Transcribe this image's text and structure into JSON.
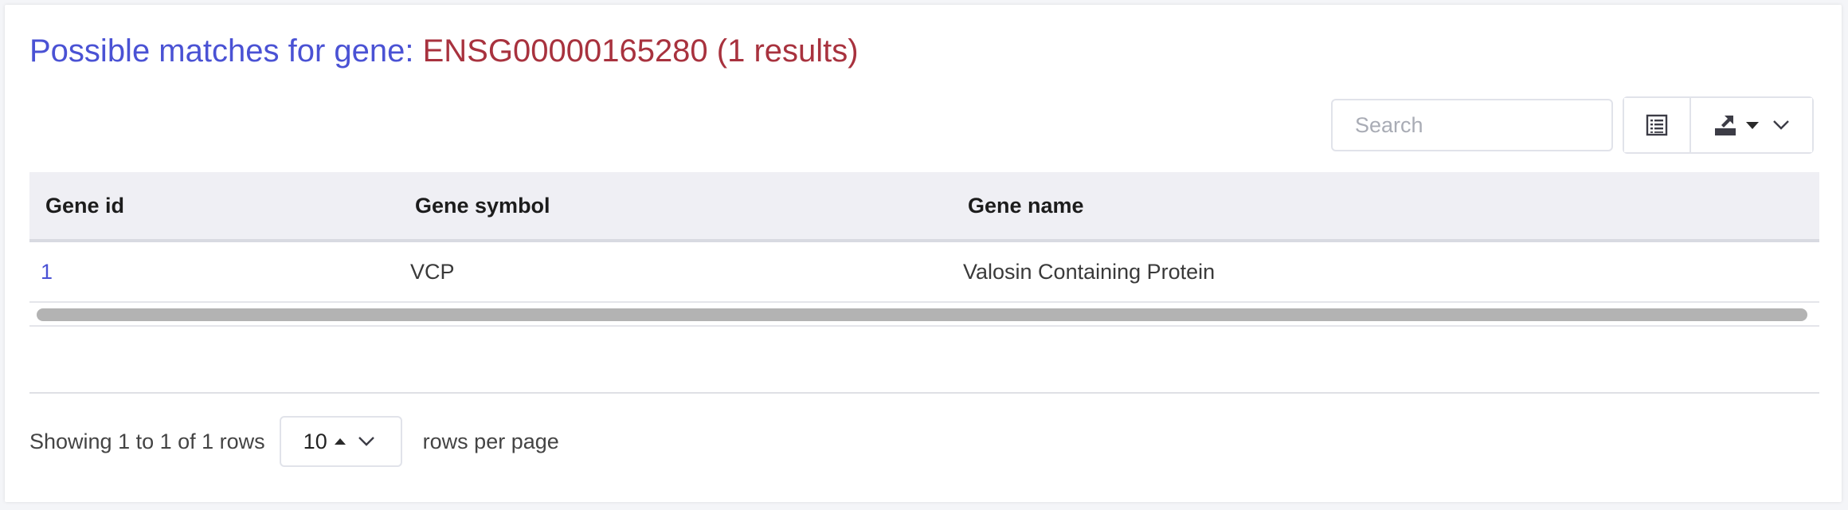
{
  "title": {
    "lead": "Possible matches for gene:",
    "gene": "ENSG00000165280 (1 results)"
  },
  "toolbar": {
    "search_placeholder": "Search",
    "columns_icon": "columns-list-icon",
    "export_icon": "export-download-icon",
    "caret_icon": "caret-down-icon",
    "chevron_icon": "chevron-down-icon"
  },
  "table": {
    "headers": [
      "Gene id",
      "Gene symbol",
      "Gene name"
    ],
    "rows": [
      {
        "gene_id": "1",
        "gene_symbol": "VCP",
        "gene_name": "Valosin Containing Protein"
      }
    ]
  },
  "footer": {
    "showing": "Showing 1 to 1 of 1 rows",
    "page_size": "10",
    "rows_per_page": "rows per page"
  },
  "colors": {
    "title_lead": "#4a52d4",
    "title_gene": "#a8323e",
    "link": "#4a52d4",
    "header_bg": "#efeff4"
  }
}
